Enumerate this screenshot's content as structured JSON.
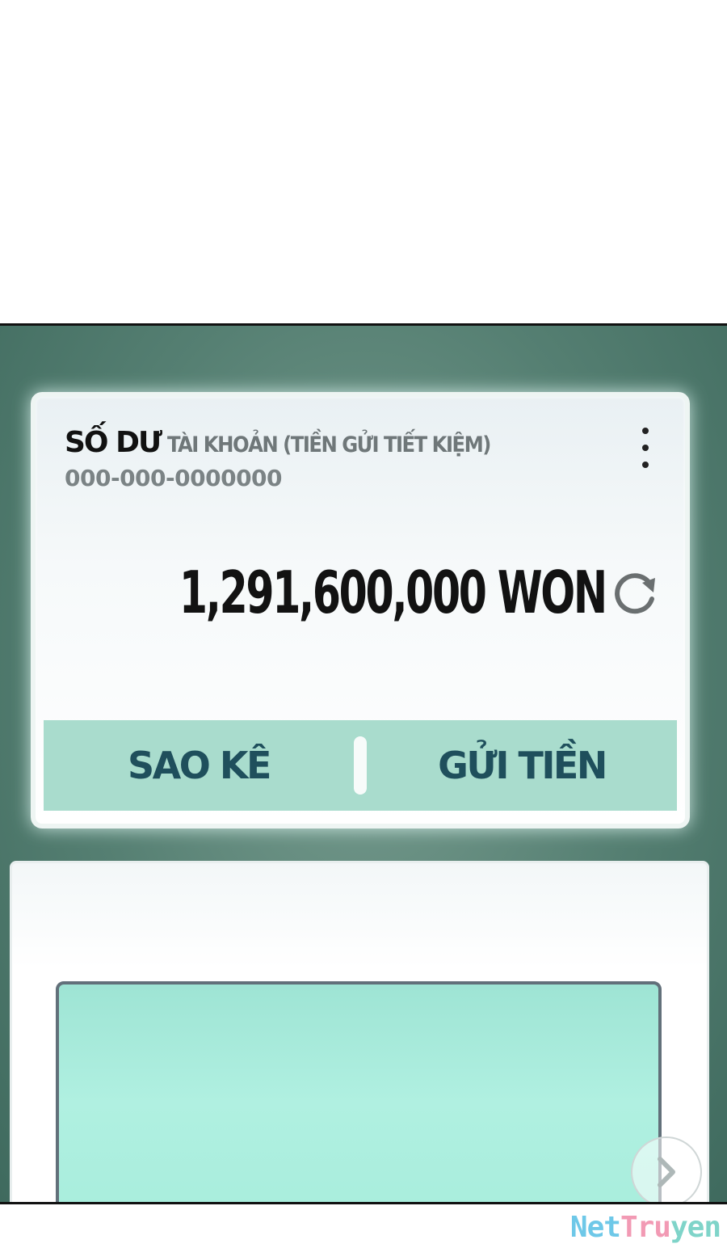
{
  "balance_card": {
    "title_strong": "SỐ DƯ",
    "title_light": "TÀI KHOẢN (TIỀN GỬI TIẾT KIỆM)",
    "account_number": "000-000-0000000",
    "amount": "1,291,600,000 WON",
    "more_icon": "kebab-menu-icon",
    "refresh_icon": "refresh-icon"
  },
  "actions": {
    "statement_label": "SAO KÊ",
    "transfer_label": "GỬI TIỀN"
  },
  "lower_card": {
    "next_icon": "chevron-right-icon"
  },
  "watermark": {
    "part1": "Net",
    "part2": "Tru",
    "part3": "yen"
  },
  "colors": {
    "panel_bg": "#557f72",
    "action_bar": "#a9dccd",
    "action_text": "#1f4f5c",
    "mint_box": "#a8eddc"
  }
}
